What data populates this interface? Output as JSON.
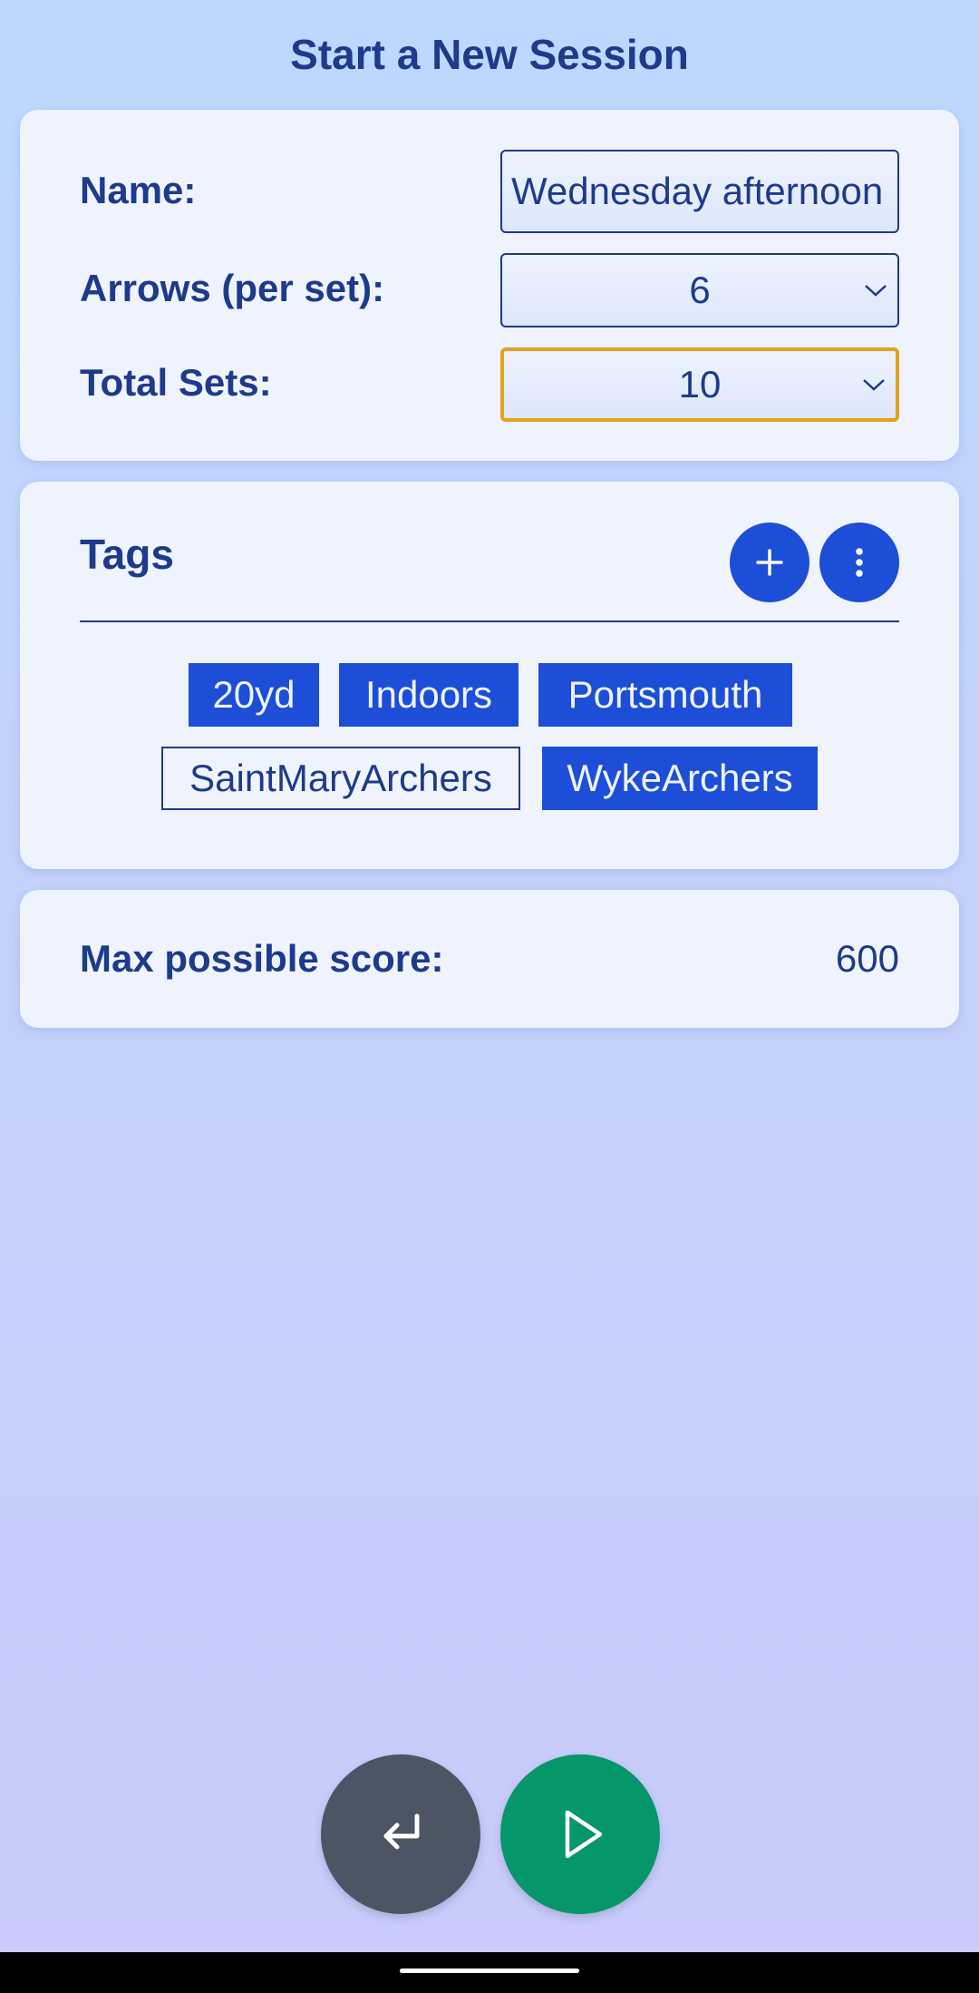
{
  "header": {
    "title": "Start a New Session"
  },
  "session_form": {
    "name_label": "Name:",
    "name_value": "Wednesday afternoon",
    "arrows_label": "Arrows (per set):",
    "arrows_value": "6",
    "sets_label": "Total Sets:",
    "sets_value": "10"
  },
  "tags": {
    "title": "Tags",
    "add_icon": "plus-icon",
    "more_icon": "more-vertical-icon",
    "items": [
      {
        "label": "20yd",
        "selected": true
      },
      {
        "label": "Indoors",
        "selected": true
      },
      {
        "label": "Portsmouth",
        "selected": true
      },
      {
        "label": "SaintMaryArchers",
        "selected": false
      },
      {
        "label": "WykeArchers",
        "selected": true
      }
    ]
  },
  "score": {
    "label": "Max possible score:",
    "value": "600"
  },
  "actions": {
    "back_icon": "return-arrow-icon",
    "start_icon": "play-icon"
  },
  "colors": {
    "accent": "#1d4ed8",
    "text": "#1e3a8a",
    "focus_border": "#e3a11c",
    "back_button": "#4b5563",
    "start_button": "#059669"
  }
}
